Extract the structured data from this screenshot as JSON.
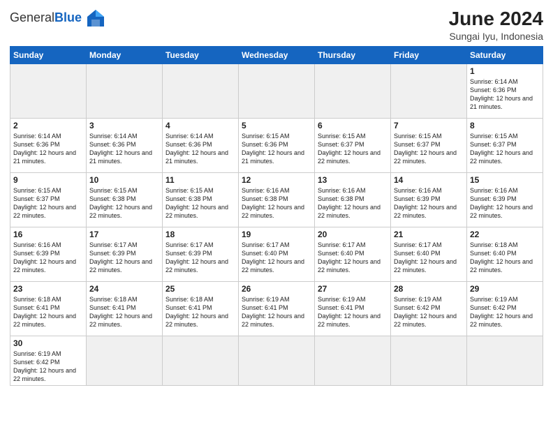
{
  "logo": {
    "text_general": "General",
    "text_blue": "Blue"
  },
  "title": "June 2024",
  "location": "Sungai Iyu, Indonesia",
  "days_header": [
    "Sunday",
    "Monday",
    "Tuesday",
    "Wednesday",
    "Thursday",
    "Friday",
    "Saturday"
  ],
  "weeks": [
    [
      {
        "date": "",
        "info": ""
      },
      {
        "date": "",
        "info": ""
      },
      {
        "date": "",
        "info": ""
      },
      {
        "date": "",
        "info": ""
      },
      {
        "date": "",
        "info": ""
      },
      {
        "date": "",
        "info": ""
      },
      {
        "date": "1",
        "info": "Sunrise: 6:14 AM\nSunset: 6:36 PM\nDaylight: 12 hours and 21 minutes."
      }
    ],
    [
      {
        "date": "2",
        "info": "Sunrise: 6:14 AM\nSunset: 6:36 PM\nDaylight: 12 hours and 21 minutes."
      },
      {
        "date": "3",
        "info": "Sunrise: 6:14 AM\nSunset: 6:36 PM\nDaylight: 12 hours and 21 minutes."
      },
      {
        "date": "4",
        "info": "Sunrise: 6:14 AM\nSunset: 6:36 PM\nDaylight: 12 hours and 21 minutes."
      },
      {
        "date": "5",
        "info": "Sunrise: 6:15 AM\nSunset: 6:36 PM\nDaylight: 12 hours and 21 minutes."
      },
      {
        "date": "6",
        "info": "Sunrise: 6:15 AM\nSunset: 6:37 PM\nDaylight: 12 hours and 22 minutes."
      },
      {
        "date": "7",
        "info": "Sunrise: 6:15 AM\nSunset: 6:37 PM\nDaylight: 12 hours and 22 minutes."
      },
      {
        "date": "8",
        "info": "Sunrise: 6:15 AM\nSunset: 6:37 PM\nDaylight: 12 hours and 22 minutes."
      }
    ],
    [
      {
        "date": "9",
        "info": "Sunrise: 6:15 AM\nSunset: 6:37 PM\nDaylight: 12 hours and 22 minutes."
      },
      {
        "date": "10",
        "info": "Sunrise: 6:15 AM\nSunset: 6:38 PM\nDaylight: 12 hours and 22 minutes."
      },
      {
        "date": "11",
        "info": "Sunrise: 6:15 AM\nSunset: 6:38 PM\nDaylight: 12 hours and 22 minutes."
      },
      {
        "date": "12",
        "info": "Sunrise: 6:16 AM\nSunset: 6:38 PM\nDaylight: 12 hours and 22 minutes."
      },
      {
        "date": "13",
        "info": "Sunrise: 6:16 AM\nSunset: 6:38 PM\nDaylight: 12 hours and 22 minutes."
      },
      {
        "date": "14",
        "info": "Sunrise: 6:16 AM\nSunset: 6:39 PM\nDaylight: 12 hours and 22 minutes."
      },
      {
        "date": "15",
        "info": "Sunrise: 6:16 AM\nSunset: 6:39 PM\nDaylight: 12 hours and 22 minutes."
      }
    ],
    [
      {
        "date": "16",
        "info": "Sunrise: 6:16 AM\nSunset: 6:39 PM\nDaylight: 12 hours and 22 minutes."
      },
      {
        "date": "17",
        "info": "Sunrise: 6:17 AM\nSunset: 6:39 PM\nDaylight: 12 hours and 22 minutes."
      },
      {
        "date": "18",
        "info": "Sunrise: 6:17 AM\nSunset: 6:39 PM\nDaylight: 12 hours and 22 minutes."
      },
      {
        "date": "19",
        "info": "Sunrise: 6:17 AM\nSunset: 6:40 PM\nDaylight: 12 hours and 22 minutes."
      },
      {
        "date": "20",
        "info": "Sunrise: 6:17 AM\nSunset: 6:40 PM\nDaylight: 12 hours and 22 minutes."
      },
      {
        "date": "21",
        "info": "Sunrise: 6:17 AM\nSunset: 6:40 PM\nDaylight: 12 hours and 22 minutes."
      },
      {
        "date": "22",
        "info": "Sunrise: 6:18 AM\nSunset: 6:40 PM\nDaylight: 12 hours and 22 minutes."
      }
    ],
    [
      {
        "date": "23",
        "info": "Sunrise: 6:18 AM\nSunset: 6:41 PM\nDaylight: 12 hours and 22 minutes."
      },
      {
        "date": "24",
        "info": "Sunrise: 6:18 AM\nSunset: 6:41 PM\nDaylight: 12 hours and 22 minutes."
      },
      {
        "date": "25",
        "info": "Sunrise: 6:18 AM\nSunset: 6:41 PM\nDaylight: 12 hours and 22 minutes."
      },
      {
        "date": "26",
        "info": "Sunrise: 6:19 AM\nSunset: 6:41 PM\nDaylight: 12 hours and 22 minutes."
      },
      {
        "date": "27",
        "info": "Sunrise: 6:19 AM\nSunset: 6:41 PM\nDaylight: 12 hours and 22 minutes."
      },
      {
        "date": "28",
        "info": "Sunrise: 6:19 AM\nSunset: 6:42 PM\nDaylight: 12 hours and 22 minutes."
      },
      {
        "date": "29",
        "info": "Sunrise: 6:19 AM\nSunset: 6:42 PM\nDaylight: 12 hours and 22 minutes."
      }
    ],
    [
      {
        "date": "30",
        "info": "Sunrise: 6:19 AM\nSunset: 6:42 PM\nDaylight: 12 hours and 22 minutes."
      },
      {
        "date": "",
        "info": ""
      },
      {
        "date": "",
        "info": ""
      },
      {
        "date": "",
        "info": ""
      },
      {
        "date": "",
        "info": ""
      },
      {
        "date": "",
        "info": ""
      },
      {
        "date": "",
        "info": ""
      }
    ]
  ]
}
